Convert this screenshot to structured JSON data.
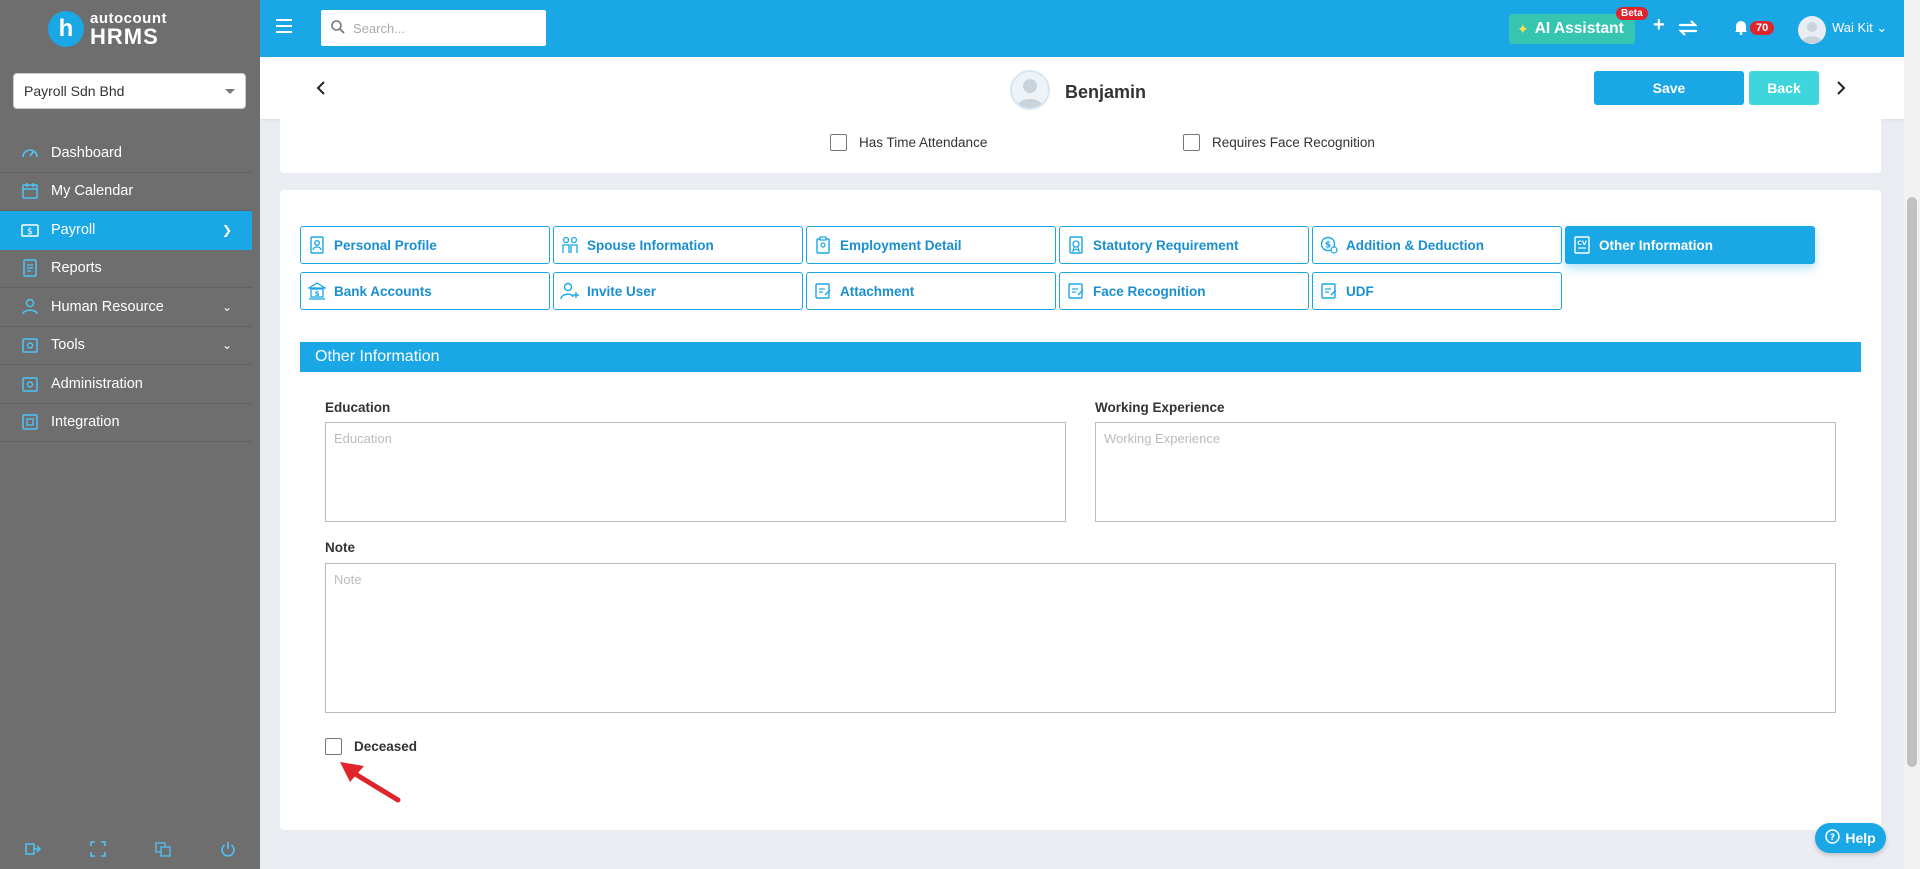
{
  "app": {
    "logo_mark": "h",
    "logo_small": "autocount",
    "logo_big": "HRMS",
    "company": "Payroll Sdn Bhd"
  },
  "sidebar": {
    "items": [
      {
        "label": "Dashboard",
        "icon": "dashboard-icon"
      },
      {
        "label": "My Calendar",
        "icon": "calendar-icon"
      },
      {
        "label": "Payroll",
        "icon": "payroll-icon",
        "active": true
      },
      {
        "label": "Reports",
        "icon": "reports-icon"
      },
      {
        "label": "Human Resource",
        "icon": "human-resource-icon"
      },
      {
        "label": "Tools",
        "icon": "tools-icon"
      },
      {
        "label": "Administration",
        "icon": "administration-icon"
      },
      {
        "label": "Integration",
        "icon": "integration-icon"
      }
    ]
  },
  "topbar": {
    "search_placeholder": "Search...",
    "ai_label": "AI Assistant",
    "beta": "Beta",
    "notification_count": "70",
    "user": "Wai Kit"
  },
  "header": {
    "employee_name": "Benjamin",
    "save_label": "Save",
    "back_label": "Back"
  },
  "checks_top": {
    "time_attendance": "Has Time Attendance",
    "face_recognition": "Requires Face Recognition"
  },
  "tabs": [
    "Personal Profile",
    "Spouse Information",
    "Employment Detail",
    "Statutory Requirement",
    "Addition & Deduction",
    "Other Information",
    "Bank Accounts",
    "Invite User",
    "Attachment",
    "Face Recognition",
    "UDF"
  ],
  "section": {
    "title": "Other Information",
    "education_label": "Education",
    "education_placeholder": "Education",
    "experience_label": "Working Experience",
    "experience_placeholder": "Working Experience",
    "note_label": "Note",
    "note_placeholder": "Note",
    "deceased_label": "Deceased"
  },
  "help_label": "Help",
  "colors": {
    "primary": "#1aa7e5",
    "sidebar": "#6e6e6e",
    "back_button": "#3ed6dc",
    "ai_button": "#35c5b0",
    "badge": "#e0242c"
  }
}
